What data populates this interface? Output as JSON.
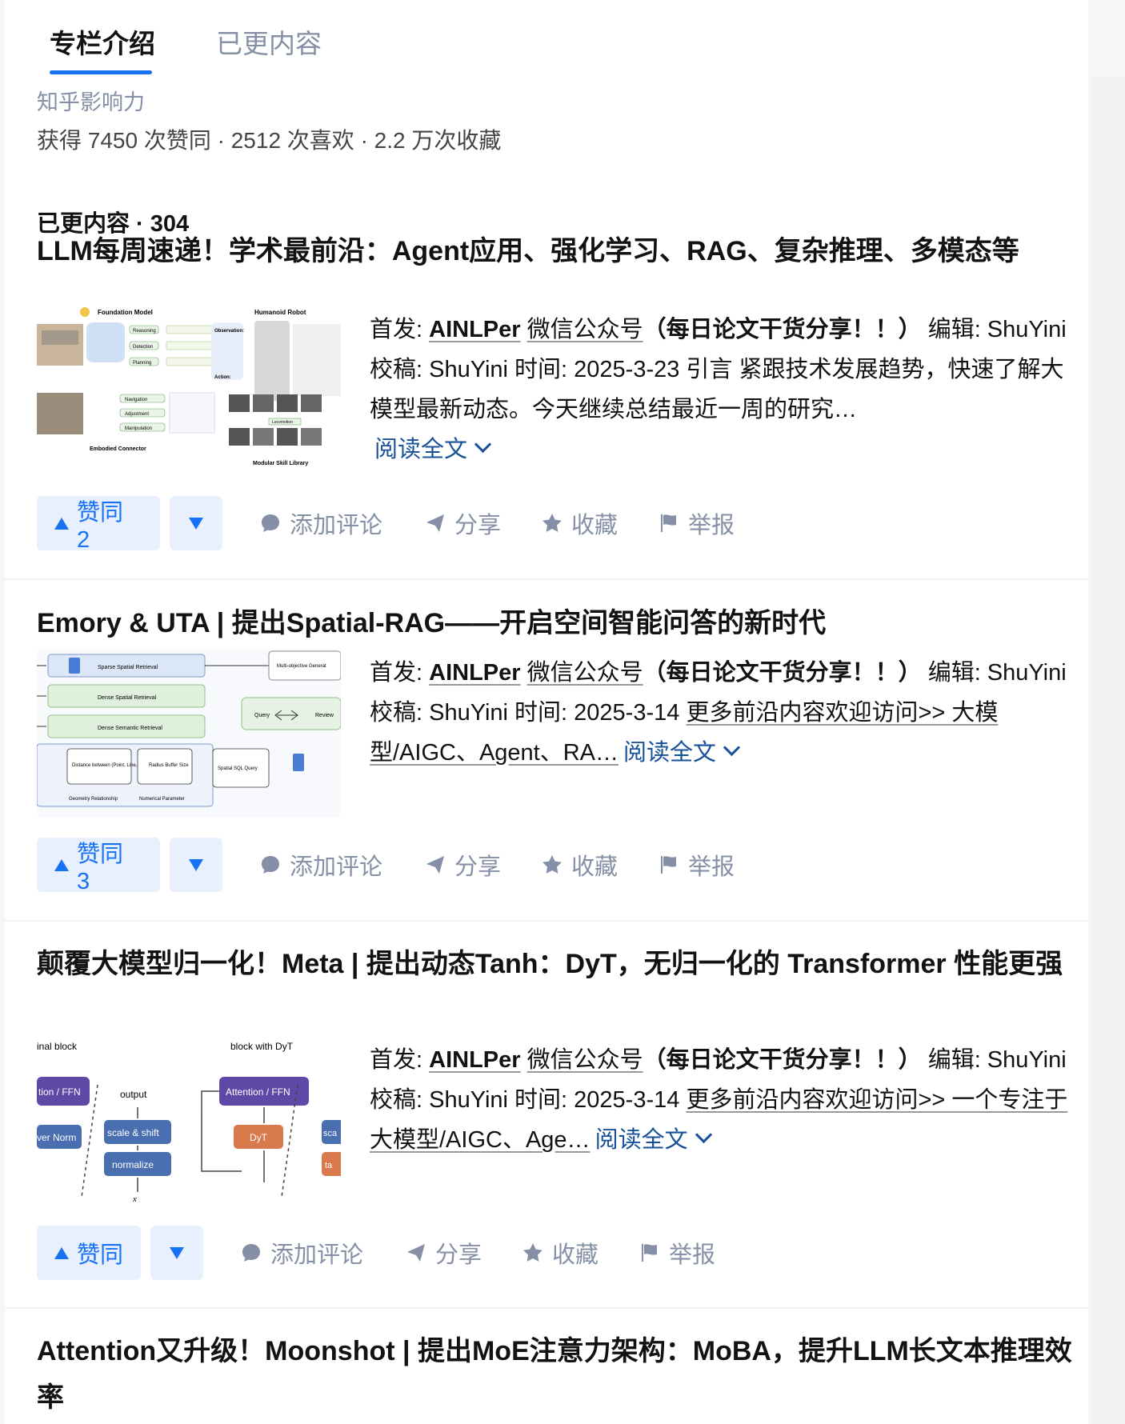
{
  "tabs": [
    {
      "label": "专栏介绍",
      "active": true
    },
    {
      "label": "已更内容",
      "active": false
    }
  ],
  "influence": {
    "title": "知乎影响力",
    "stats": "获得 7450 次赞同 · 2512 次喜欢 · 2.2 万次收藏"
  },
  "content_count": "已更内容 · 304",
  "actions": {
    "comment": "添加评论",
    "share": "分享",
    "favorite": "收藏",
    "report": "举报",
    "read_more": "阅读全文"
  },
  "articles": [
    {
      "title": "LLM每周速递！学术最前沿：Agent应用、强化学习、RAG、复杂推理、多模态等",
      "excerpt_prefix": "首发: ",
      "source_bold": "AINLPer",
      "source_link": "微信公众号",
      "tagline": "（每日论文干货分享！！）",
      "rest": " 编辑: ShuYini 校稿: ShuYini 时间: 2025-3-23 引言 紧跟技术发展趋势，快速了解大模型最新动态。今天继续总结最近一周的研究…",
      "vote_label": "赞同 2",
      "thumb": {
        "labels": [
          "Foundation Model",
          "Humanoid Robot",
          "Reasoning",
          "Detection",
          "Planning",
          "Navigation",
          "Adjustment",
          "Manipulation",
          "Embodied Connector",
          "Modular Skill Library",
          "Observation:",
          "Action:",
          "Locomotion"
        ]
      }
    },
    {
      "title": "Emory & UTA | 提出Spatial-RAG——开启空间智能问答的新时代",
      "excerpt_prefix": "首发: ",
      "source_bold": "AINLPer",
      "source_link": "微信公众号",
      "tagline": "（每日论文干货分享！！）",
      "rest": " 编辑: ShuYini 校稿: ShuYini 时间: 2025-3-14 ",
      "link_more": "更多前沿内容欢迎访问>> 大模型/AIGC、Agent、RA…",
      "vote_label": "赞同 3",
      "thumb": {
        "labels": [
          "Sparse Spatial Retrieval",
          "Dense Spatial Retrieval",
          "Dense Semantic Retrieval",
          "Multi-objective Generat",
          "Query",
          "Review",
          "Distance between (Point, Line, Polygon)",
          "Radius Buffer Size",
          "Spatial SQL Query",
          "Geometry Relationship",
          "Numerical Parameter"
        ]
      }
    },
    {
      "title": "颠覆大模型归一化！Meta | 提出动态Tanh：DyT，无归一化的 Transformer 性能更强",
      "excerpt_prefix": "首发: ",
      "source_bold": "AINLPer",
      "source_link": "微信公众号",
      "tagline": "（每日论文干货分享！！）",
      "rest": " 编辑: ShuYini 校稿: ShuYini 时间: 2025-3-14 ",
      "link_more": "更多前沿内容欢迎访问>> 一个专注于大模型/AIGC、Age…",
      "vote_label": "赞同",
      "thumb": {
        "labels": [
          "inal block",
          "block with DyT",
          "tion / FFN",
          "output",
          "Attention / FFN",
          "scale & shift",
          "ver Norm",
          "DyT",
          "normalize",
          "sca",
          "ta"
        ]
      }
    },
    {
      "title": "Attention又升级！Moonshot | 提出MoE注意力架构：MoBA，提升LLM长文本推理效率"
    }
  ]
}
